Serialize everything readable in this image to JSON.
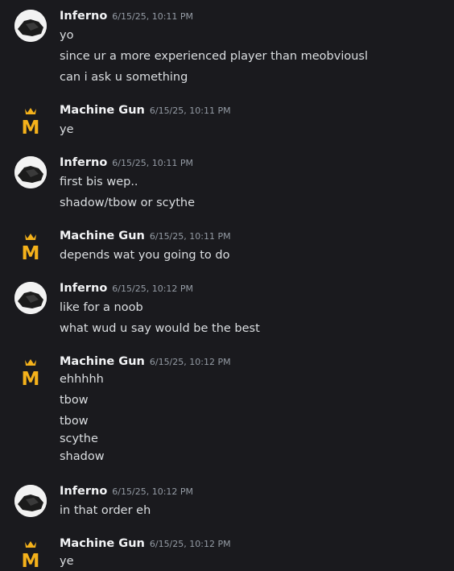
{
  "messages": [
    {
      "author": "Inferno",
      "timestamp": "6/15/25, 10:11 PM",
      "avatar": "inferno-avatar",
      "lines": [
        "yo",
        "since ur a more experienced player than meobviousl",
        "can i ask u something"
      ]
    },
    {
      "author": "Machine Gun",
      "timestamp": "6/15/25, 10:11 PM",
      "avatar": "crown-m-avatar",
      "lines": [
        "ye"
      ]
    },
    {
      "author": "Inferno",
      "timestamp": "6/15/25, 10:11 PM",
      "avatar": "inferno-avatar",
      "lines": [
        "first bis wep..",
        "shadow/tbow or scythe"
      ]
    },
    {
      "author": "Machine Gun",
      "timestamp": "6/15/25, 10:11 PM",
      "avatar": "crown-m-avatar",
      "lines": [
        "depends wat you going to do"
      ]
    },
    {
      "author": "Inferno",
      "timestamp": "6/15/25, 10:12 PM",
      "avatar": "inferno-avatar",
      "lines": [
        "like for a noob",
        "what wud u say would be the best"
      ]
    },
    {
      "author": "Machine Gun",
      "timestamp": "6/15/25, 10:12 PM",
      "avatar": "crown-m-avatar",
      "lines": [
        "ehhhhh",
        "tbow",
        "tbow",
        "scythe",
        "shadow"
      ]
    },
    {
      "author": "Inferno",
      "timestamp": "6/15/25, 10:12 PM",
      "avatar": "inferno-avatar",
      "lines": [
        "in that order eh"
      ]
    },
    {
      "author": "Machine Gun",
      "timestamp": "6/15/25, 10:12 PM",
      "avatar": "crown-m-avatar",
      "lines": [
        "ye"
      ]
    }
  ],
  "colors": {
    "background": "#1a1a1e",
    "author": "#f2f3f5",
    "timestamp": "#949ba4",
    "text": "#dbdee1",
    "crown": "#f5b21b"
  }
}
